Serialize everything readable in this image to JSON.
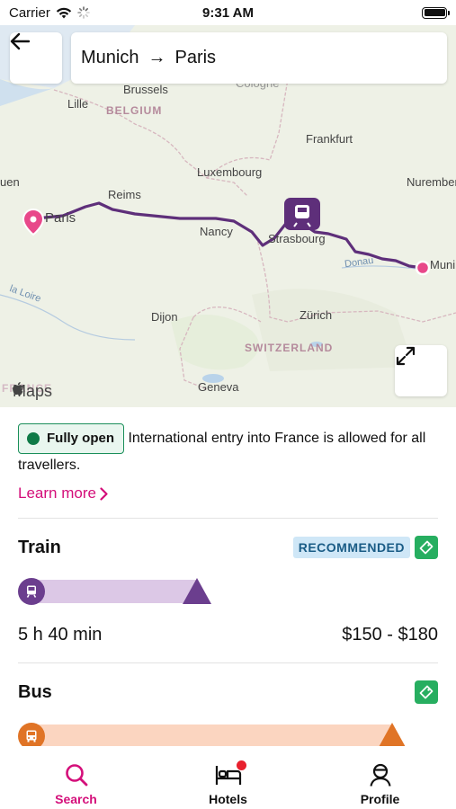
{
  "status": {
    "carrier": "Carrier",
    "time": "9:31 AM"
  },
  "search": {
    "from": "Munich",
    "to": "Paris",
    "arrow": "→"
  },
  "map": {
    "attribution": "Maps",
    "labels": [
      "Brussels",
      "Lille",
      "BELGIUM",
      "Cologne",
      "Frankfurt",
      "Luxembourg",
      "Reims",
      "Paris",
      "Nancy",
      "Strasbourg",
      "Nuremberg",
      "Muni",
      "Donau",
      "Dijon",
      "Zürich",
      "SWITZERLAND",
      "Geneva",
      "la Loire",
      "uen",
      "FRANCE"
    ]
  },
  "notice": {
    "badge": "Fully open",
    "text": "International entry into France is allowed for all travellers.",
    "link": "Learn more"
  },
  "modes": [
    {
      "name": "Train",
      "badge": "RECOMMENDED",
      "duration": "5 h 40 min",
      "price": "$150 - $180",
      "color": "#6b3e8e",
      "bar_color": "#dcc8e6",
      "relative_length": 0.44
    },
    {
      "name": "Bus",
      "badge": "",
      "duration": "",
      "price": "",
      "color": "#e07426",
      "bar_color": "#fbd5c0",
      "relative_length": 0.92
    }
  ],
  "tabs": [
    {
      "label": "Search",
      "icon": "search-icon",
      "active": true
    },
    {
      "label": "Hotels",
      "icon": "bed-icon",
      "active": false,
      "notification": true
    },
    {
      "label": "Profile",
      "icon": "profile-icon",
      "active": false
    }
  ],
  "colors": {
    "accent": "#d40f7a",
    "route": "#5e2f7a",
    "open": "#0f7a47",
    "recommended_bg": "#cfe7f7"
  }
}
